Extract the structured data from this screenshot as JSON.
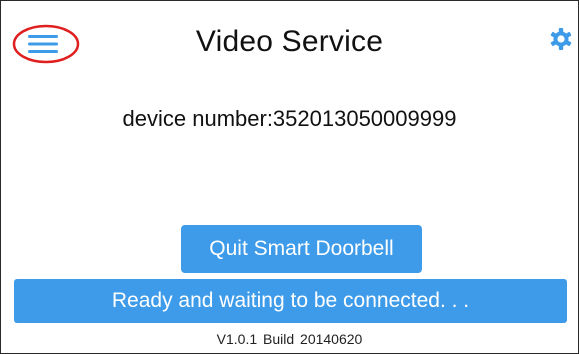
{
  "header": {
    "title": "Video Service",
    "menu_icon": "hamburger-menu-icon",
    "settings_icon": "gear-icon"
  },
  "device": {
    "number_text": "device number:352013050009999"
  },
  "actions": {
    "quit_label": "Quit Smart Doorbell"
  },
  "status": {
    "text": "Ready and waiting to be connected. . ."
  },
  "footer": {
    "version": "V1.0.1  Build 20140620"
  },
  "colors": {
    "accent": "#3d9be9",
    "annotation_circle": "#e02020",
    "background": "#ffffff",
    "text": "#111111"
  }
}
